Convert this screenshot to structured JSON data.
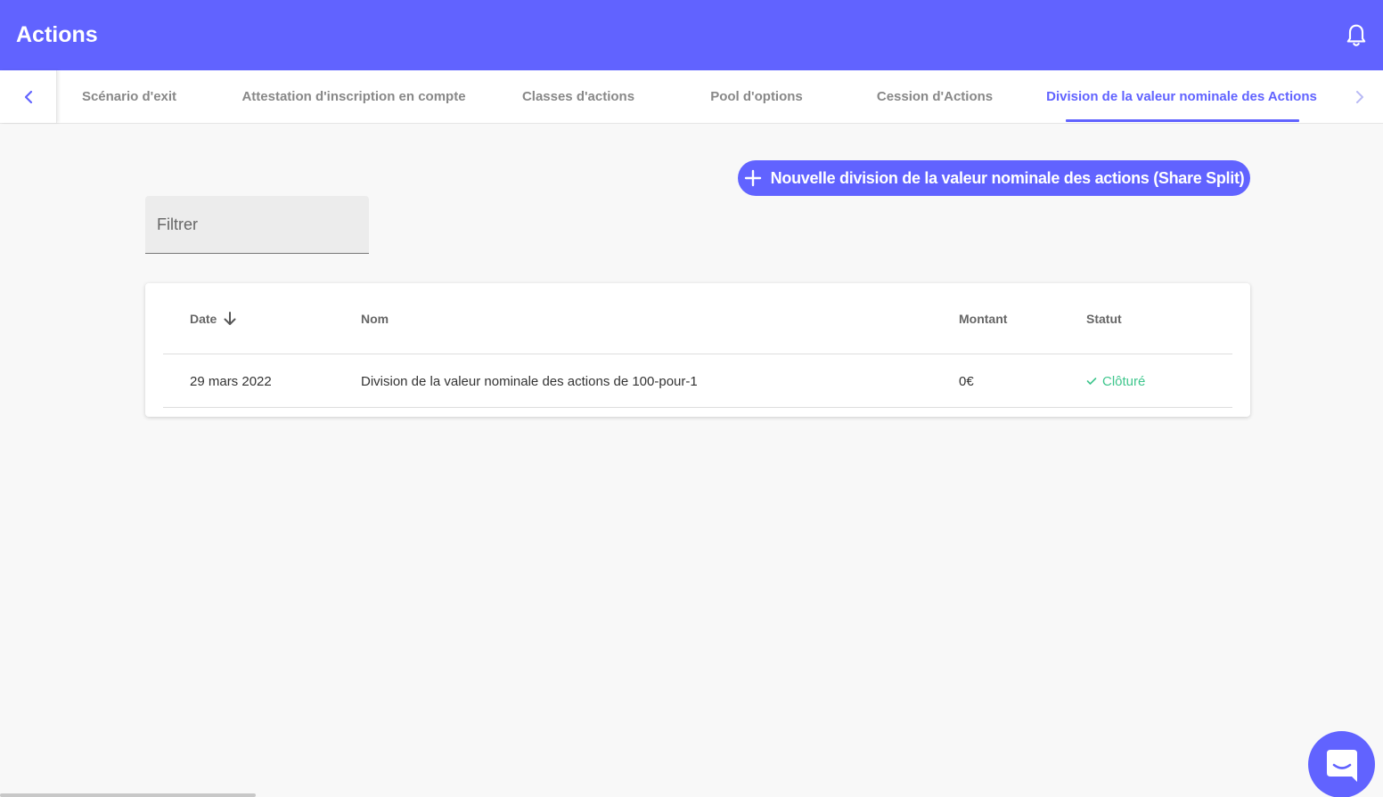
{
  "app_bar": {
    "title": "Actions",
    "bell_icon": "bell-icon",
    "background_color": "#6163ff"
  },
  "tabs": {
    "left_icon": "chevron-left-icon",
    "right_icon": "chevron-right-icon",
    "items": [
      {
        "label": "Scénario d'exit",
        "active": false
      },
      {
        "label": "Attestation d'inscription en compte",
        "active": false
      },
      {
        "label": "Classes d'actions",
        "active": false
      },
      {
        "label": "Pool d'options",
        "active": false
      },
      {
        "label": "Cession d'Actions",
        "active": false
      },
      {
        "label": "Division de la valeur nominale des Actions",
        "active": true
      }
    ]
  },
  "actions": {
    "new_button_label": "Nouvelle division de la valeur nominale des actions (Share Split)",
    "new_button_icon": "plus-icon"
  },
  "filter": {
    "placeholder": "Filtrer",
    "value": ""
  },
  "table": {
    "columns": {
      "date": "Date",
      "nom": "Nom",
      "montant": "Montant",
      "statut": "Statut"
    },
    "sort_icon": "arrow-down-icon",
    "rows": [
      {
        "date": "29 mars 2022",
        "nom": "Division de la valeur nominale des actions de 100-pour-1",
        "montant": "0€",
        "statut": "Clôturé",
        "statut_icon": "check-icon",
        "statut_color": "#3fc68d"
      }
    ]
  },
  "chat": {
    "icon": "chat-icon"
  }
}
